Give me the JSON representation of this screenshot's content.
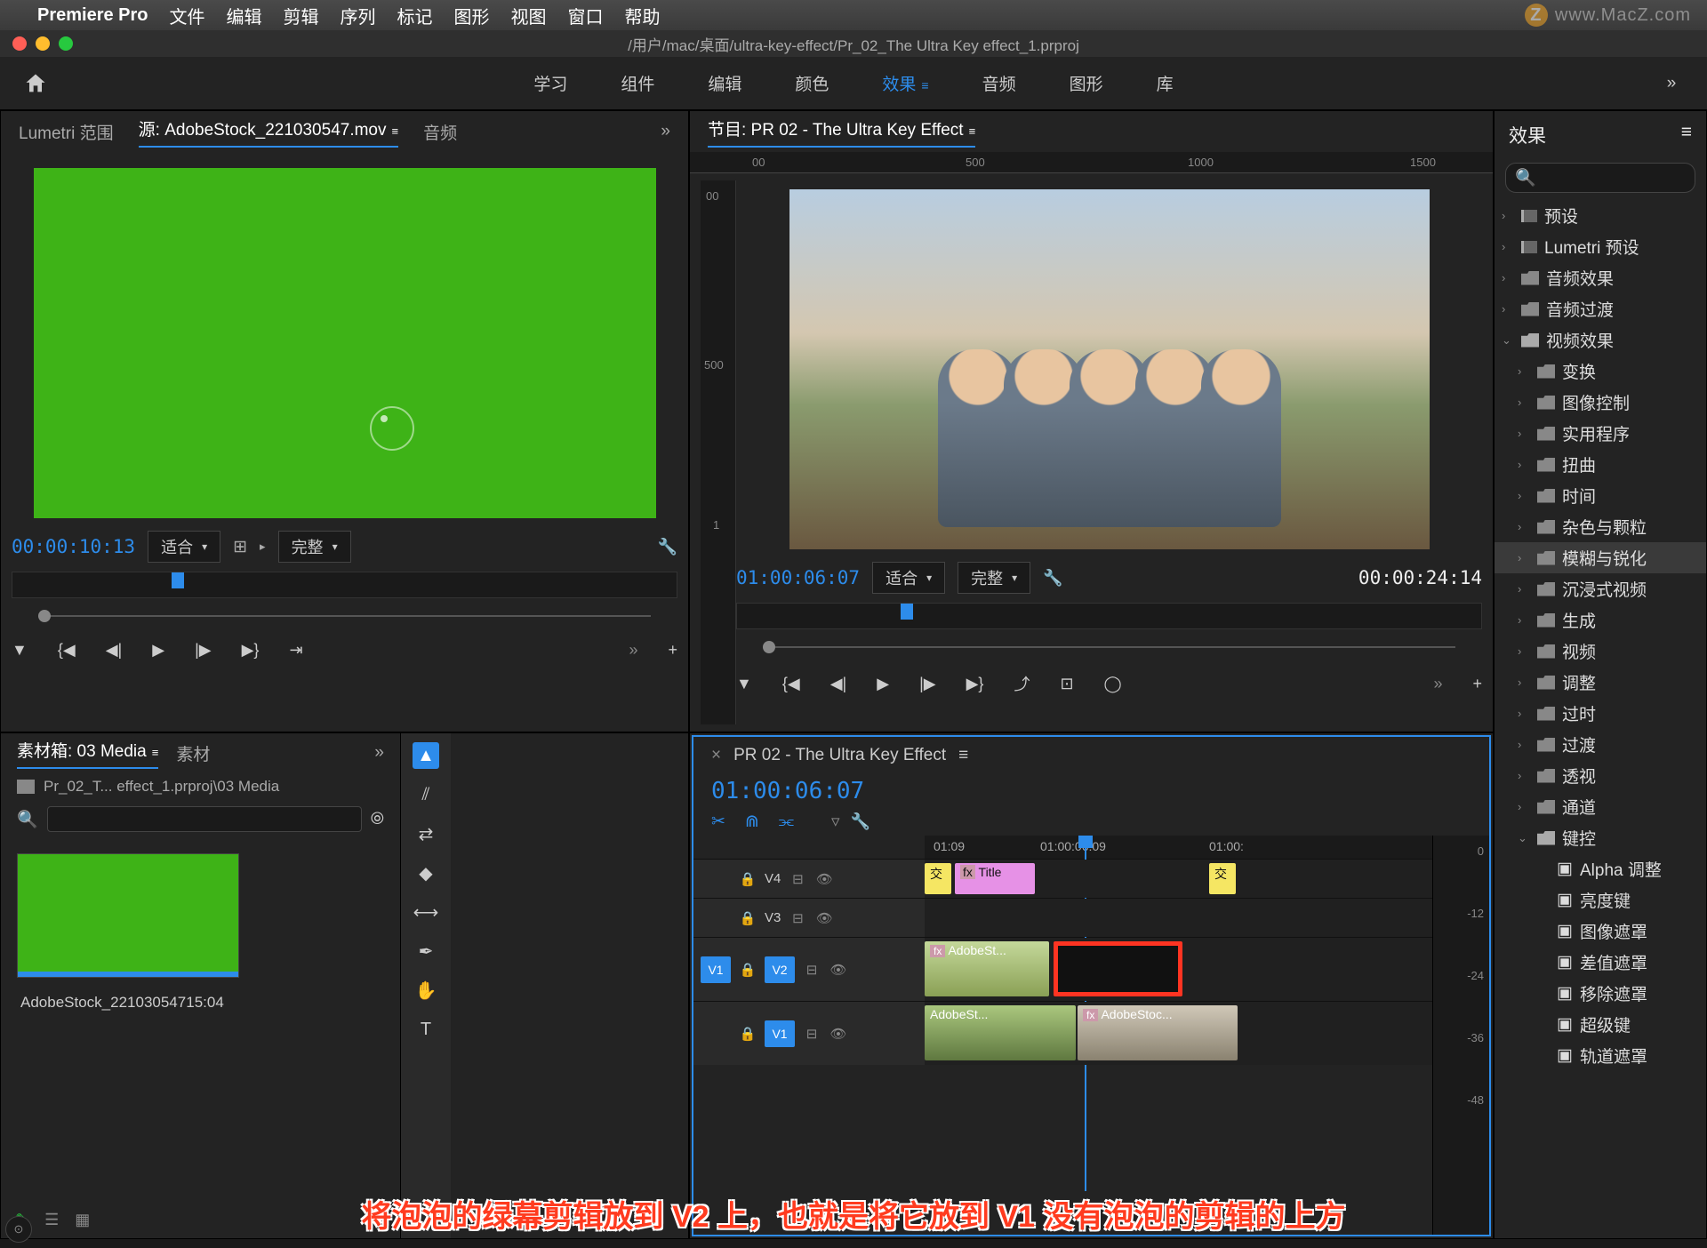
{
  "mac_menu": {
    "app": "Premiere Pro",
    "items": [
      "文件",
      "编辑",
      "剪辑",
      "序列",
      "标记",
      "图形",
      "视图",
      "窗口",
      "帮助"
    ]
  },
  "watermark": "www.MacZ.com",
  "window_title": "/用户/mac/桌面/ultra-key-effect/Pr_02_The Ultra Key effect_1.prproj",
  "workspaces": [
    "学习",
    "组件",
    "编辑",
    "颜色",
    "效果",
    "音频",
    "图形",
    "库"
  ],
  "workspace_active_index": 4,
  "source": {
    "tabs": [
      "Lumetri 范围",
      "源: AdobeStock_221030547.mov",
      "音频"
    ],
    "active_tab": 1,
    "timecode": "00:00:10:13",
    "fit": "适合",
    "quality": "完整"
  },
  "program": {
    "title": "节目: PR 02 - The Ultra Key Effect",
    "ruler": [
      "00",
      "500",
      "1000",
      "1500"
    ],
    "timecode": "01:00:06:07",
    "fit": "适合",
    "quality": "完整",
    "duration": "00:00:24:14"
  },
  "effects": {
    "title": "效果",
    "search_placeholder": "",
    "tree": [
      {
        "lvl": 0,
        "chev": "›",
        "icon": "preset",
        "label": "预设"
      },
      {
        "lvl": 0,
        "chev": "›",
        "icon": "preset",
        "label": "Lumetri 预设"
      },
      {
        "lvl": 0,
        "chev": "›",
        "icon": "fold",
        "label": "音频效果"
      },
      {
        "lvl": 0,
        "chev": "›",
        "icon": "fold",
        "label": "音频过渡"
      },
      {
        "lvl": 0,
        "chev": "⌄",
        "icon": "fold-open",
        "label": "视频效果"
      },
      {
        "lvl": 1,
        "chev": "›",
        "icon": "fold",
        "label": "变换"
      },
      {
        "lvl": 1,
        "chev": "›",
        "icon": "fold",
        "label": "图像控制"
      },
      {
        "lvl": 1,
        "chev": "›",
        "icon": "fold",
        "label": "实用程序"
      },
      {
        "lvl": 1,
        "chev": "›",
        "icon": "fold",
        "label": "扭曲"
      },
      {
        "lvl": 1,
        "chev": "›",
        "icon": "fold",
        "label": "时间"
      },
      {
        "lvl": 1,
        "chev": "›",
        "icon": "fold",
        "label": "杂色与颗粒"
      },
      {
        "lvl": 1,
        "chev": "›",
        "icon": "fold",
        "label": "模糊与锐化",
        "sel": true
      },
      {
        "lvl": 1,
        "chev": "›",
        "icon": "fold",
        "label": "沉浸式视频"
      },
      {
        "lvl": 1,
        "chev": "›",
        "icon": "fold",
        "label": "生成"
      },
      {
        "lvl": 1,
        "chev": "›",
        "icon": "fold",
        "label": "视频"
      },
      {
        "lvl": 1,
        "chev": "›",
        "icon": "fold",
        "label": "调整"
      },
      {
        "lvl": 1,
        "chev": "›",
        "icon": "fold",
        "label": "过时"
      },
      {
        "lvl": 1,
        "chev": "›",
        "icon": "fold",
        "label": "过渡"
      },
      {
        "lvl": 1,
        "chev": "›",
        "icon": "fold",
        "label": "透视"
      },
      {
        "lvl": 1,
        "chev": "›",
        "icon": "fold",
        "label": "通道"
      },
      {
        "lvl": 1,
        "chev": "⌄",
        "icon": "fold-open",
        "label": "键控"
      },
      {
        "lvl": 2,
        "chev": "",
        "icon": "fx",
        "label": "Alpha 调整"
      },
      {
        "lvl": 2,
        "chev": "",
        "icon": "fx",
        "label": "亮度键"
      },
      {
        "lvl": 2,
        "chev": "",
        "icon": "fx",
        "label": "图像遮罩"
      },
      {
        "lvl": 2,
        "chev": "",
        "icon": "fx",
        "label": "差值遮罩"
      },
      {
        "lvl": 2,
        "chev": "",
        "icon": "fx",
        "label": "移除遮罩"
      },
      {
        "lvl": 2,
        "chev": "",
        "icon": "fx",
        "label": "超级键"
      },
      {
        "lvl": 2,
        "chev": "",
        "icon": "fx",
        "label": "轨道遮罩"
      }
    ]
  },
  "project": {
    "tabs": [
      "素材箱: 03 Media",
      "素材"
    ],
    "path": "Pr_02_T... effect_1.prproj\\03 Media",
    "thumb_label": "AdobeStock_221030547",
    "thumb_dur": "15:04"
  },
  "timeline": {
    "title": "PR 02 - The Ultra Key Effect",
    "timecode": "01:00:06:07",
    "ruler": [
      "01:09",
      "01:00:06:09",
      "01:00:"
    ],
    "tracks": {
      "v4": "V4",
      "v3": "V3",
      "v2": "V2",
      "v1": "V1",
      "src_v1": "V1"
    },
    "clips": {
      "title": "Title",
      "v2a": "AdobeSt...",
      "v1a": "AdobeSt...",
      "v1b": "AdobeStoc...",
      "cross": "交"
    },
    "meter_scale": [
      "0",
      "-12",
      "-24",
      "-36",
      "-48"
    ]
  },
  "annotation": "将泡泡的绿幕剪辑放到 V2 上，也就是将它放到 V1 没有泡泡的剪辑的上方"
}
